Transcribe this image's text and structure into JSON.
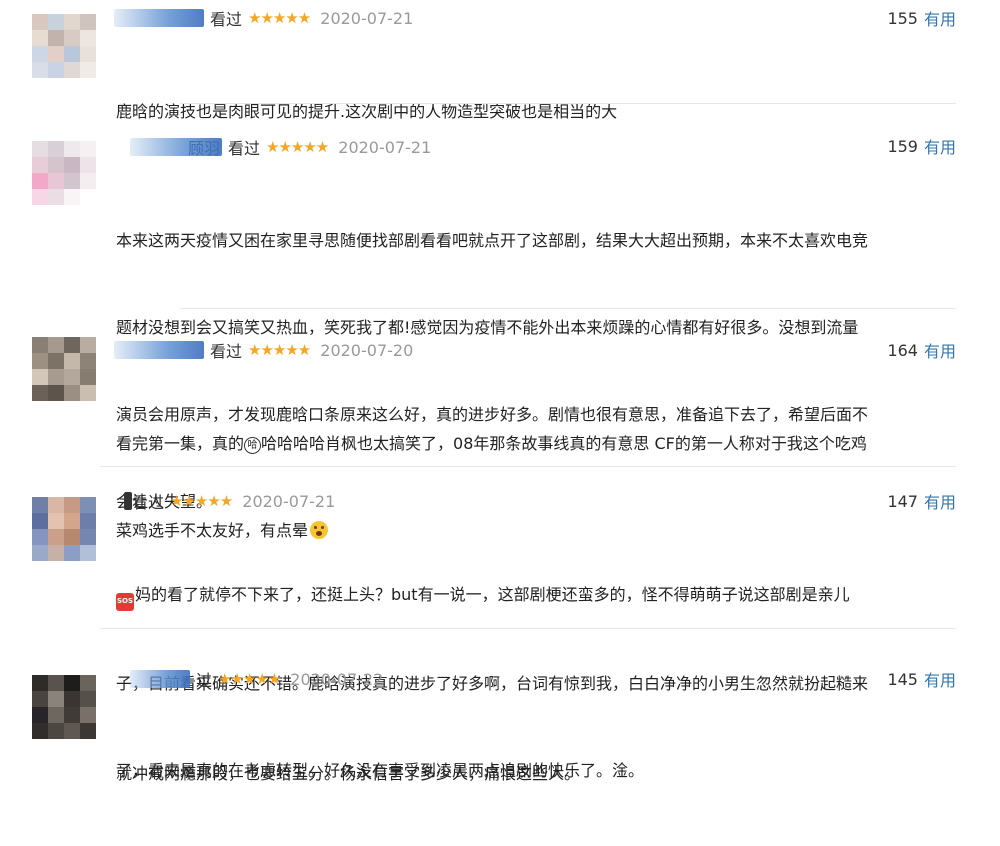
{
  "comments": [
    {
      "name_tail": "",
      "status": "看过",
      "stars": "★★★★★",
      "date": "2020-07-21",
      "votes": "155",
      "useful_label": "有用",
      "lines": [
        "鹿晗的演技也是肉眼可见的提升.这次剧中的人物造型突破也是相当的大"
      ]
    },
    {
      "name_tail": "顾羽",
      "status": "看过",
      "stars": "★★★★★",
      "date": "2020-07-21",
      "votes": "159",
      "useful_label": "有用",
      "lines": [
        "本来这两天疫情又困在家里寻思随便找部剧看看吧就点开了这部剧，结果大大超出预期，本来不太喜欢电竞",
        "题材没想到会又搞笑又热血，笑死我了都!感觉因为疫情不能外出本来烦躁的心情都有好很多。没想到流量",
        "演员会用原声，才发现鹿晗口条原来这么好，真的进步好多。剧情也很有意思，准备追下去了，希望后面不",
        "会让人失望。"
      ]
    },
    {
      "name_tail": "",
      "status": "看过",
      "stars": "★★★★★",
      "date": "2020-07-20",
      "votes": "164",
      "useful_label": "有用",
      "line1_a": "看完第一集，真的",
      "circle_char": "哈",
      "line1_b": "哈哈哈哈肖枫也太搞笑了，08年那条故事线真的有意思 CF的第一人称对于我这个吃鸡",
      "line2": "菜鸡选手不太友好，有点晕"
    },
    {
      "name_tail": "",
      "status": "看过",
      "stars": "★★★★★",
      "date": "2020-07-21",
      "votes": "147",
      "useful_label": "有用",
      "sos_label": "SOS",
      "line1": "妈的看了就停不下来了，还挺上头？but有一说一，这部剧梗还蛮多的，怪不得萌萌子说这部剧是亲儿",
      "lines_rest": [
        "子，目前看来确实还不错。鹿晗演技真的进步了好多啊，台词有惊到我，白白净净的小男生忽然就扮起糙来",
        "了，看来是真的在考虑转型。好久没有享受到凌晨两点追剧的快乐了。淦。"
      ]
    },
    {
      "name_tail": "",
      "status": "过",
      "stars": "★★★★★",
      "date": "2020-07-22",
      "votes": "145",
      "useful_label": "有用",
      "lines": [
        "就冲戒网瘾那段，也要给五分。杨永信害了多少人，痛恨这些人。"
      ]
    }
  ],
  "colors": {
    "star": "#f5a623",
    "useful_link": "#3377aa",
    "date": "#999999",
    "divider": "#e6e6e6"
  },
  "icons": {
    "sos": "sos-emoji-icon",
    "face": "dizzy-face-emoji-icon"
  }
}
